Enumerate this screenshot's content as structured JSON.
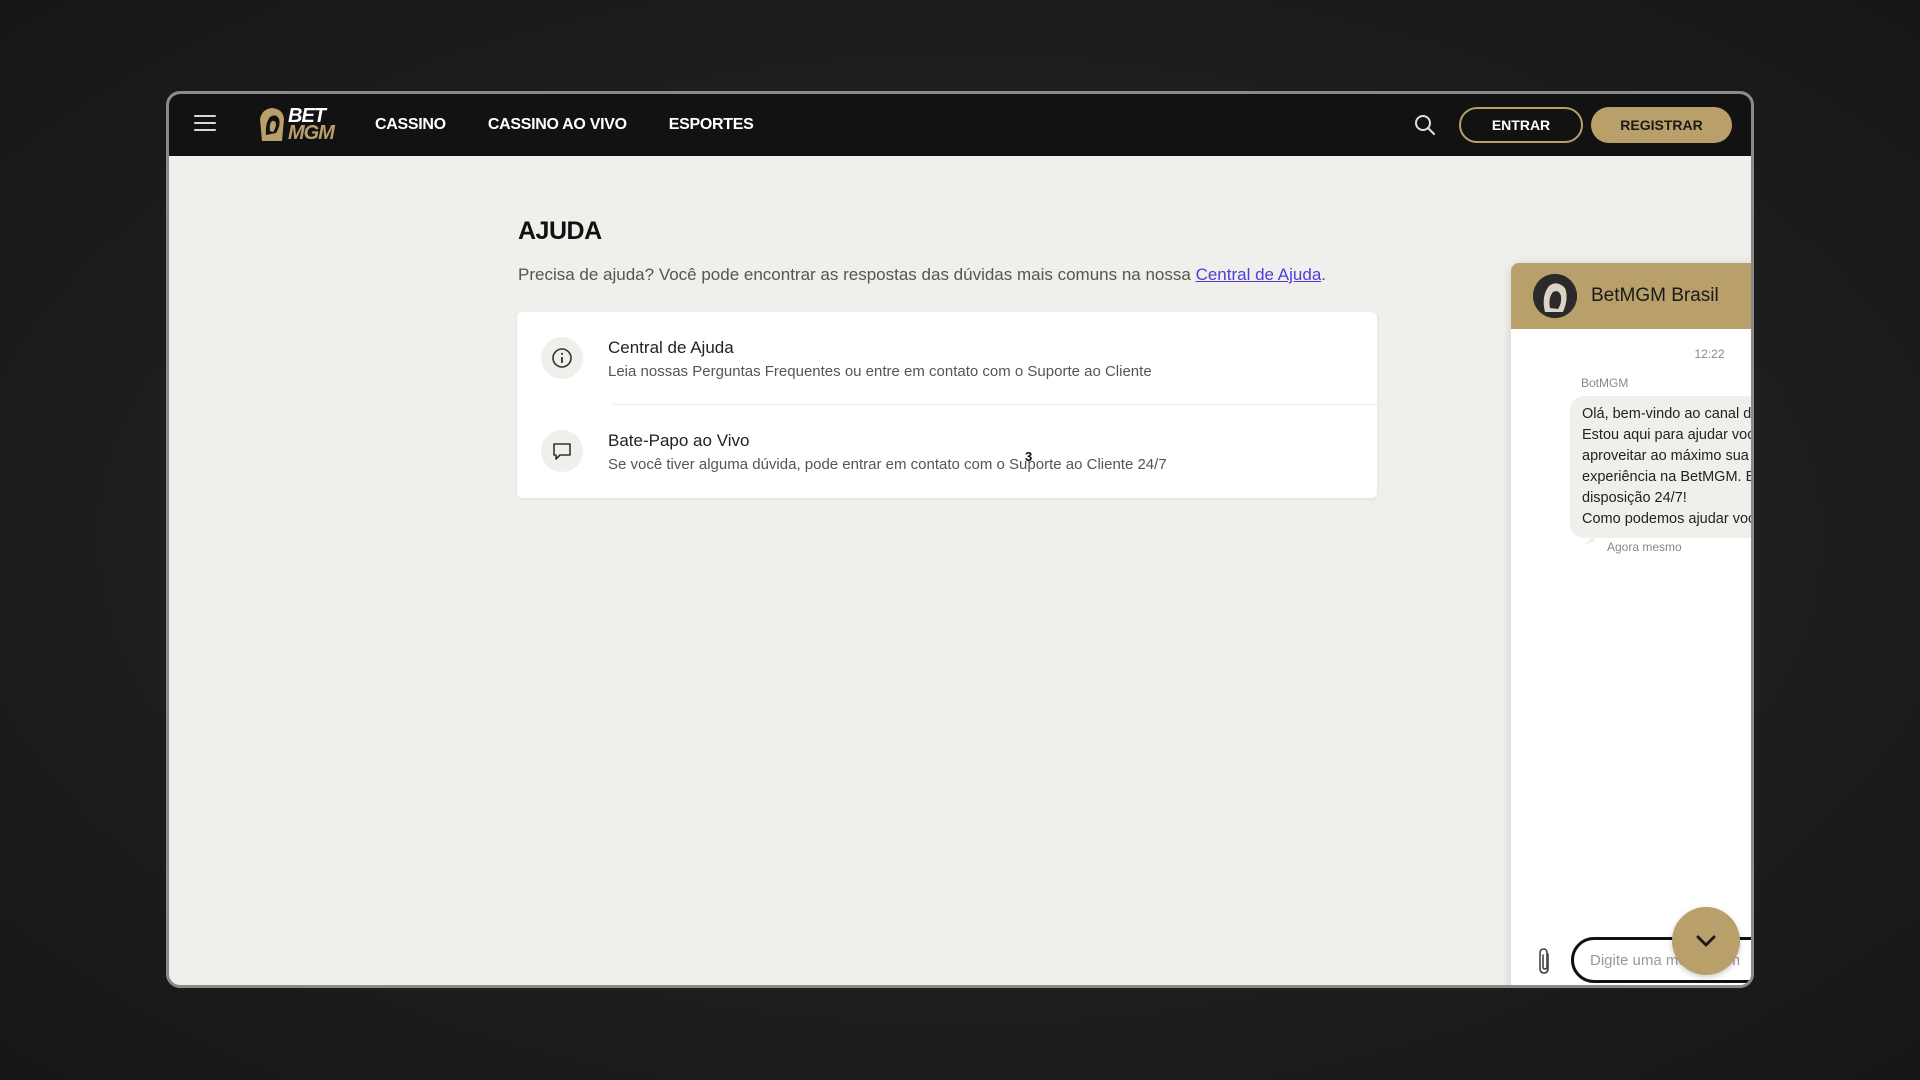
{
  "brand": {
    "logo_top": "BET",
    "logo_bottom": "MGM",
    "accent": "#b9a06a",
    "topbar_bg": "#121212"
  },
  "nav": {
    "items": [
      {
        "label": "CASSINO"
      },
      {
        "label": "CASSINO AO VIVO"
      },
      {
        "label": "ESPORTES"
      }
    ],
    "login_label": "ENTRAR",
    "register_label": "REGISTRAR",
    "icons": [
      "hamburger-menu-icon",
      "search-icon"
    ]
  },
  "help": {
    "title": "AJUDA",
    "intro_text": "Precisa de ajuda? Você pode encontrar as respostas das dúvidas mais comuns na nossa ",
    "intro_link": "Central de Ajuda",
    "intro_end": ".",
    "rows": [
      {
        "title": "Central de Ajuda",
        "description": "Leia nossas Perguntas Frequentes ou entre em contato com o Suporte ao Cliente",
        "icon": "info-icon"
      },
      {
        "title": "Bate-Papo ao Vivo",
        "description": "Se você tiver alguma dúvida, pode entrar em contato com o Suporte ao Cliente 24/7",
        "icon": "chat-bubble-icon"
      }
    ],
    "badge": "3"
  },
  "chat": {
    "title": "BetMGM Brasil",
    "time": "12:22",
    "sender": "BotMGM",
    "message_lines": [
      "Olá, bem-vindo ao canal do chat!🦁",
      "Estou aqui para ajudar você a",
      "aproveitar ao máximo sua",
      "experiência na BetMGM. Estou à",
      "disposição 24/7!",
      "Como podemos ajudar você hoje?"
    ],
    "status": "Agora mesmo",
    "input_placeholder": "Digite uma mensagem",
    "icons": [
      "more-vertical-icon",
      "paperclip-icon",
      "chevron-down-icon"
    ]
  }
}
